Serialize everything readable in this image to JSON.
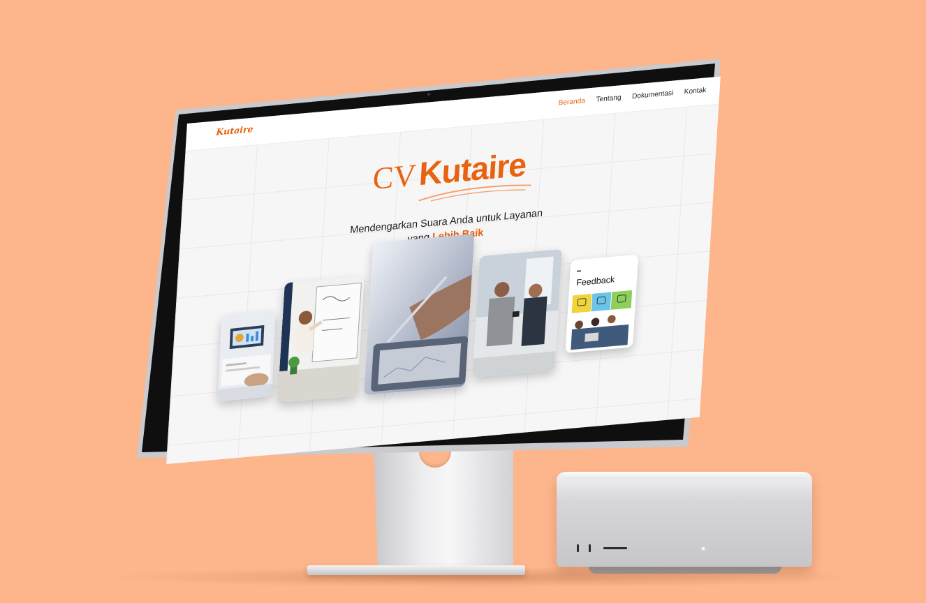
{
  "site": {
    "logo": "Kutaire",
    "nav": [
      {
        "label": "Beranda",
        "active": true
      },
      {
        "label": "Tentang",
        "active": false
      },
      {
        "label": "Dokumentasi",
        "active": false
      },
      {
        "label": "Kontak",
        "active": false
      }
    ],
    "hero": {
      "title_prefix": "CV",
      "title_brand": "Kutaire",
      "tagline_line1": "Mendengarkan Suara Anda untuk Layanan",
      "tagline_line2_prefix": "yang ",
      "tagline_highlight": "Lebih Baik"
    },
    "gallery": {
      "feedback_card_label": "Feedback"
    }
  },
  "colors": {
    "accent": "#e8620f",
    "background": "#fdb58c",
    "page": "#f6f6f7",
    "text": "#1d1d1f"
  }
}
